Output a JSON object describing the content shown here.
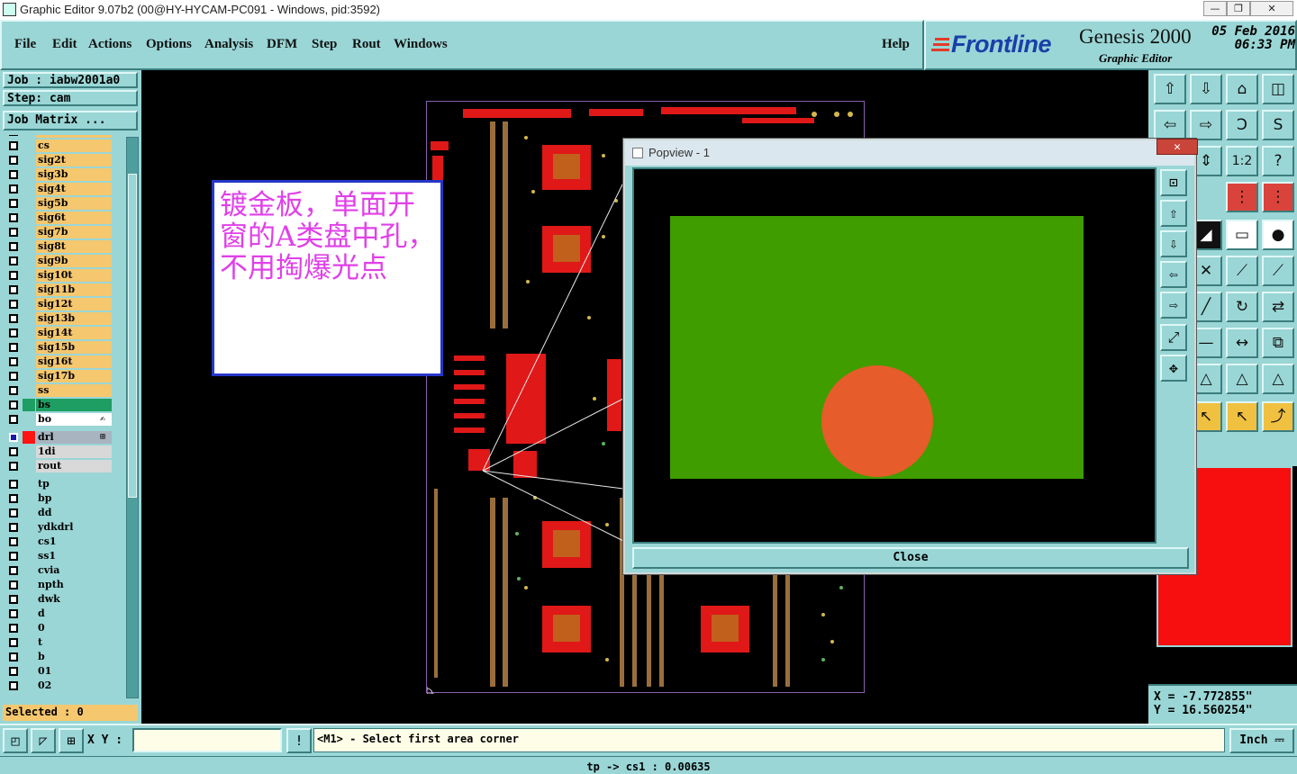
{
  "window": {
    "title": "Graphic Editor 9.07b2 (00@HY-HYCAM-PC091 - Windows, pid:3592)",
    "minimize": "—",
    "restore": "❐",
    "close": "✕"
  },
  "menu": {
    "items": [
      "File",
      "Edit",
      "Actions",
      "Options",
      "Analysis",
      "DFM",
      "Step",
      "Rout",
      "Windows"
    ],
    "help": "Help"
  },
  "brand": {
    "logo": "Frontline",
    "product": "Genesis 2000",
    "subtitle": "Graphic Editor",
    "date": "05 Feb 2016",
    "time": "06:33 PM"
  },
  "job": {
    "job_label": "Job : iabw2001a0",
    "step_label": "Step: cam",
    "matrix_button": "Job Matrix ..."
  },
  "layers": [
    {
      "name": "cs",
      "color": "#f5c76e"
    },
    {
      "name": "cs",
      "color": "#f5c76e"
    },
    {
      "name": "sig2t",
      "color": "#f5c76e"
    },
    {
      "name": "sig3b",
      "color": "#f5c76e"
    },
    {
      "name": "sig4t",
      "color": "#f5c76e"
    },
    {
      "name": "sig5b",
      "color": "#f5c76e"
    },
    {
      "name": "sig6t",
      "color": "#f5c76e"
    },
    {
      "name": "sig7b",
      "color": "#f5c76e"
    },
    {
      "name": "sig8t",
      "color": "#f5c76e"
    },
    {
      "name": "sig9b",
      "color": "#f5c76e"
    },
    {
      "name": "sig10t",
      "color": "#f5c76e"
    },
    {
      "name": "sig11b",
      "color": "#f5c76e"
    },
    {
      "name": "sig12t",
      "color": "#f5c76e"
    },
    {
      "name": "sig13b",
      "color": "#f5c76e"
    },
    {
      "name": "sig14t",
      "color": "#f5c76e"
    },
    {
      "name": "sig15b",
      "color": "#f5c76e"
    },
    {
      "name": "sig16t",
      "color": "#f5c76e"
    },
    {
      "name": "sig17b",
      "color": "#f5c76e"
    },
    {
      "name": "ss",
      "color": "#f5c76e"
    },
    {
      "name": "bs",
      "color": "#1f9e63",
      "swatch": "#1f9e63"
    },
    {
      "name": "bo",
      "color": "#ffffff",
      "suffix": "✍"
    },
    {
      "name": "drl",
      "color": "#9ad6d6",
      "swatch": "#ff1414",
      "active": true,
      "suffix": "⊞"
    },
    {
      "name": "1di",
      "color": "#d8d8d8"
    },
    {
      "name": "rout",
      "color": "#d8d8d8"
    },
    {
      "name": "tp",
      "color": "#9ad6d6"
    },
    {
      "name": "bp",
      "color": "#9ad6d6"
    },
    {
      "name": "dd",
      "color": "#9ad6d6"
    },
    {
      "name": "ydkdrl",
      "color": "#9ad6d6"
    },
    {
      "name": "cs1",
      "color": "#9ad6d6"
    },
    {
      "name": "ss1",
      "color": "#9ad6d6"
    },
    {
      "name": "cvia",
      "color": "#9ad6d6"
    },
    {
      "name": "npth",
      "color": "#9ad6d6"
    },
    {
      "name": "dwk",
      "color": "#9ad6d6"
    },
    {
      "name": "d",
      "color": "#9ad6d6"
    },
    {
      "name": "0",
      "color": "#9ad6d6"
    },
    {
      "name": "t",
      "color": "#9ad6d6"
    },
    {
      "name": "b",
      "color": "#9ad6d6"
    },
    {
      "name": "01",
      "color": "#9ad6d6"
    },
    {
      "name": "02",
      "color": "#9ad6d6"
    }
  ],
  "selected_label": "Selected : 0",
  "note": {
    "text": "镀金板，单面开窗的A类盘中孔，不用掏爆光点"
  },
  "popview": {
    "title": "Popview - 1",
    "close_x": "✕",
    "close_button": "Close",
    "area_color": "#3f9d00",
    "pad_color": "#e65c2a"
  },
  "coordinates": {
    "x": "X = -7.772855\"",
    "y": "Y = 16.560254\""
  },
  "bottom": {
    "xy_label": "X Y :",
    "xy_value": "",
    "warn_icon": "!",
    "prompt": "<M1> - Select first area corner",
    "units": "Inch"
  },
  "status": "tp -> cs1 : 0.00635"
}
